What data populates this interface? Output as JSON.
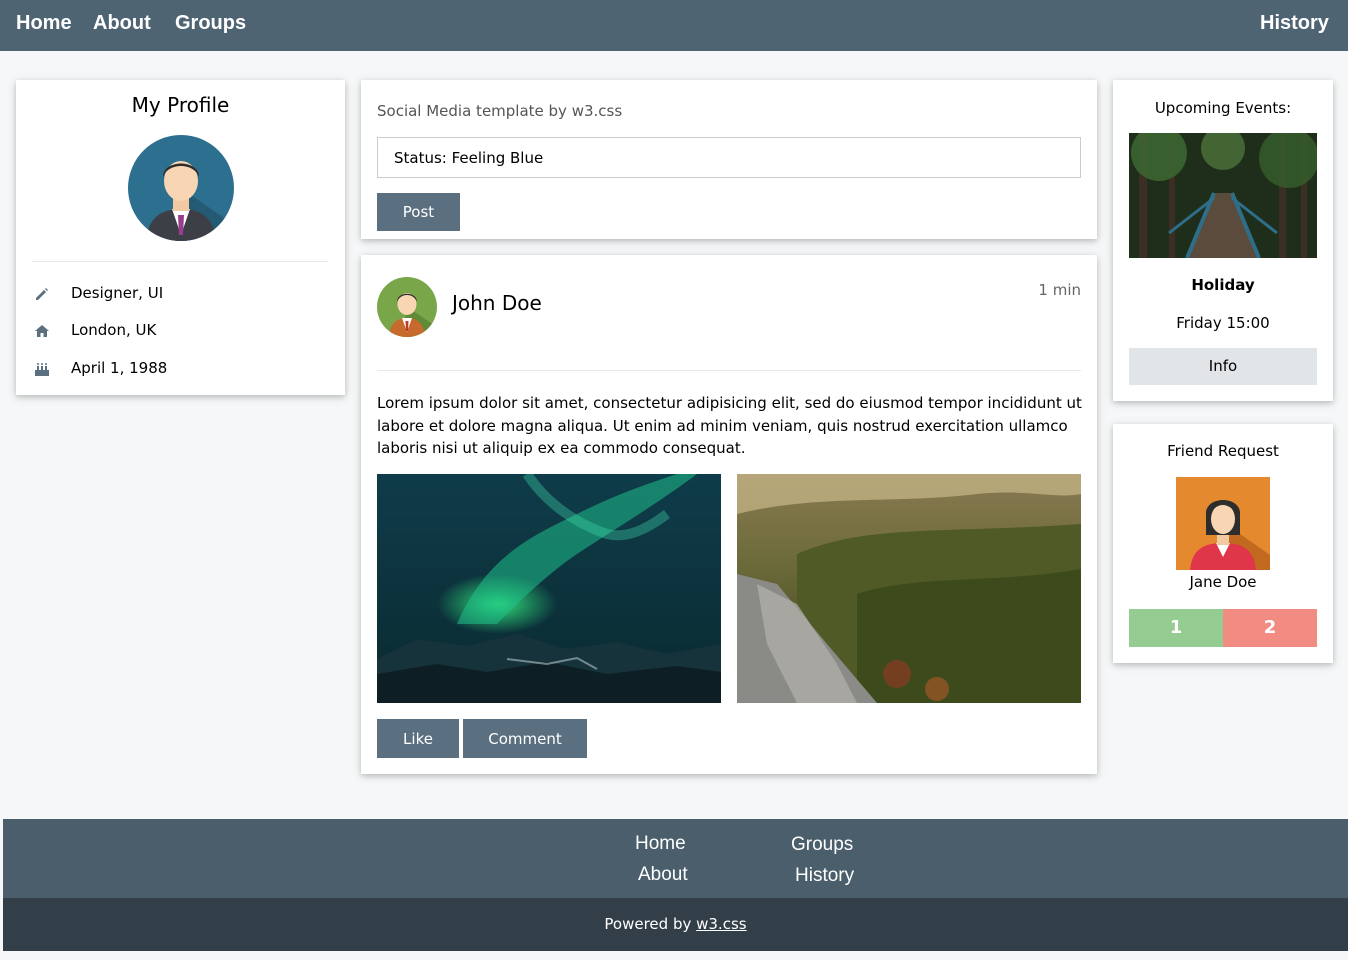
{
  "nav": {
    "home": "Home",
    "about": "About",
    "groups": "Groups",
    "history": "History"
  },
  "profile": {
    "title": "My Profile",
    "job": "Designer, UI",
    "location": "London, UK",
    "birthday": "April 1, 1988",
    "icons": [
      "pencil-icon",
      "home-icon",
      "birthday-cake-icon"
    ]
  },
  "composer": {
    "title": "Social Media template by w3.css",
    "status_value": "Status: Feeling Blue",
    "post_label": "Post"
  },
  "post": {
    "author": "John Doe",
    "time": "1 min",
    "text": "Lorem ipsum dolor sit amet, consectetur adipisicing elit, sed do eiusmod tempor incididunt ut labore et dolore magna aliqua. Ut enim ad minim veniam, quis nostrud exercitation ullamco laboris nisi ut aliquip ex ea commodo consequat.",
    "like_label": "Like",
    "comment_label": "Comment"
  },
  "events": {
    "title": "Upcoming Events:",
    "event_name": "Holiday",
    "event_time": "Friday 15:00",
    "info_label": "Info"
  },
  "friend_request": {
    "title": "Friend Request",
    "name": "Jane Doe",
    "accept_label": "1",
    "decline_label": "2",
    "accept_color": "#95cc91",
    "decline_color": "#f28b82"
  },
  "footer": {
    "links": {
      "home": "Home",
      "about": "About",
      "groups": "Groups",
      "history": "History"
    },
    "powered_prefix": "Powered by ",
    "powered_link": "w3.css"
  },
  "colors": {
    "nav_bg": "#4e6473",
    "button_bg": "#5a7080",
    "footer_top": "#4a5e6b",
    "footer_bottom": "#323e48"
  }
}
